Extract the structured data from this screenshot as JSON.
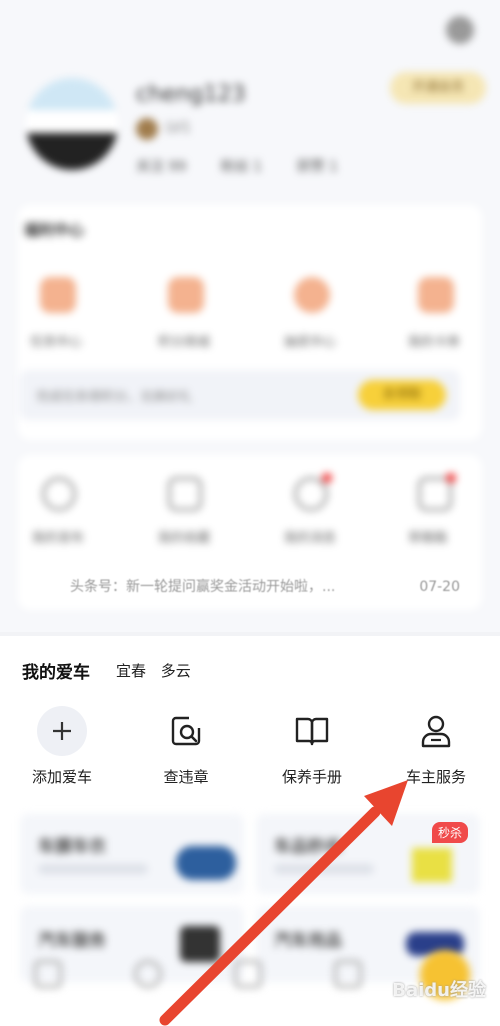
{
  "header": {
    "username": "cheng123",
    "level": "LV1",
    "stats": [
      "关注 99",
      "粉丝 1",
      "获赞 1"
    ],
    "vip_label": "开通会员"
  },
  "benefit_center": {
    "title": "福利中心",
    "items": [
      "任务中心",
      "积分商城",
      "抽奖中心",
      "我的卡券"
    ],
    "banner_text": "完成任务得积分，兑换好礼",
    "banner_button": "去领取"
  },
  "tools": {
    "items": [
      "我的发布",
      "我的收藏",
      "我的消息",
      "草稿箱"
    ],
    "news_text": "头条号：新一轮提问赢奖金活动开始啦，...",
    "news_date": "07-20"
  },
  "my_car": {
    "title": "我的爱车",
    "city": "宜春",
    "weather": "多云",
    "services": [
      {
        "label": "添加爱车",
        "icon": "plus-icon"
      },
      {
        "label": "查违章",
        "icon": "violation-search-icon"
      },
      {
        "label": "保养手册",
        "icon": "book-icon"
      },
      {
        "label": "车主服务",
        "icon": "person-icon"
      }
    ],
    "promos": [
      {
        "title": "车膜车衣"
      },
      {
        "title": "车品秒杀",
        "badge": "秒杀"
      },
      {
        "title": "汽车服务"
      },
      {
        "title": "汽车用品"
      }
    ]
  },
  "annotation": {
    "arrow_color": "#e8452f"
  },
  "watermark": "Baidu经验"
}
